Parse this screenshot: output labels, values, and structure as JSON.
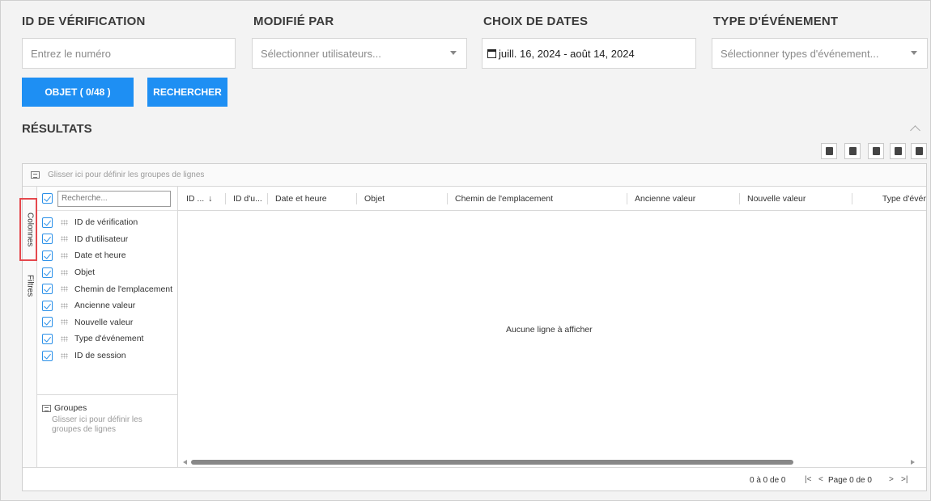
{
  "filters": {
    "id_label": "ID DE VÉRIFICATION",
    "id_placeholder": "Entrez le numéro",
    "modified_label": "MODIFIÉ PAR",
    "modified_placeholder": "Sélectionner utilisateurs...",
    "dates_label": "CHOIX DE DATES",
    "dates_value": "juill. 16, 2024 - août 14, 2024",
    "event_label": "TYPE D'ÉVÉNEMENT",
    "event_placeholder": "Sélectionner types d'événement..."
  },
  "buttons": {
    "object": "OBJET ( 0/48 )",
    "search": "RECHERCHER"
  },
  "results": {
    "title": "RÉSULTATS"
  },
  "grid": {
    "group_hint": "Glisser ici pour définir les groupes de lignes",
    "side_tabs": {
      "columns": "Colonnes",
      "filters": "Filtres"
    },
    "column_search_placeholder": "Recherche...",
    "column_list": [
      "ID de vérification",
      "ID d'utilisateur",
      "Date et heure",
      "Objet",
      "Chemin de l'emplacement",
      "Ancienne valeur",
      "Nouvelle valeur",
      "Type d'événement",
      "ID de session"
    ],
    "groups_title": "Groupes",
    "groups_hint": "Glisser ici pour définir les groupes de lignes",
    "headers": [
      "ID ...",
      "ID d'u...",
      "Date et heure",
      "Objet",
      "Chemin de l'emplacement",
      "Ancienne valeur",
      "Nouvelle valeur",
      "Type d'événe"
    ],
    "sort_arrow": "↓",
    "empty_text": "Aucune ligne à afficher",
    "footer": {
      "count": "0 à 0 de 0",
      "first": "|<",
      "prev": "<",
      "page": "Page 0 de 0",
      "next": ">",
      "last": ">|"
    }
  },
  "colors": {
    "accent": "#1e8ff3",
    "highlight": "#e5484d"
  }
}
